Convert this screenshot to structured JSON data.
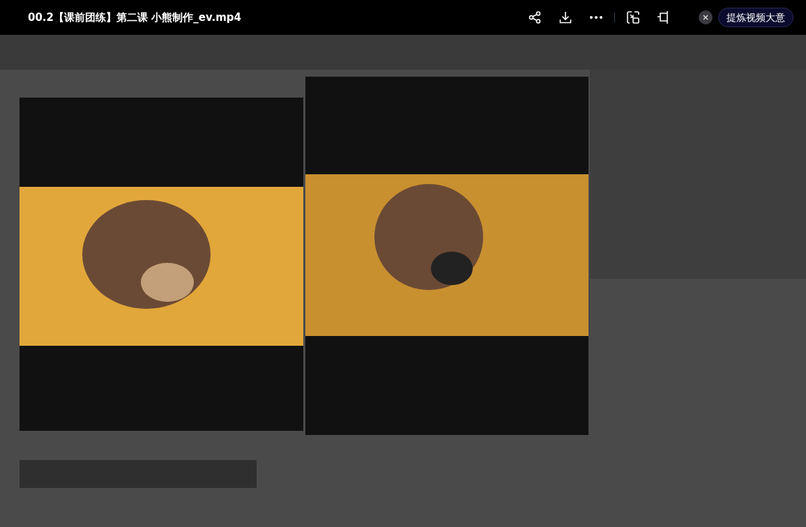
{
  "title": "00.2【课前团练】第二课 小熊制作_ev.mp4",
  "summary_button": "提炼视频大意"
}
